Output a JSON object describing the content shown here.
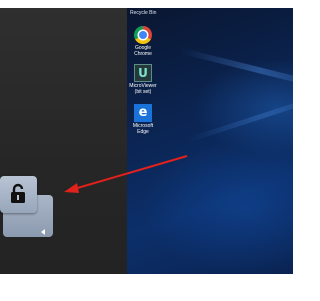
{
  "desktop": {
    "top_label": "Recycle Bin",
    "icons": [
      {
        "label_line1": "Google",
        "label_line2": "Chrome",
        "icon": "chrome-icon"
      },
      {
        "label_line1": "MicroViewer",
        "label_line2": "(bit set)",
        "icon": "app-icon",
        "glyph": "U"
      },
      {
        "label_line1": "Microsoft",
        "label_line2": "Edge",
        "icon": "edge-icon",
        "glyph": "e"
      }
    ]
  },
  "colors": {
    "arrow": "#e0211c",
    "desktop_bg": "#0b2656",
    "dark_panel": "#2a2a2a"
  },
  "lock_panel": {
    "icon": "unlock-icon"
  }
}
